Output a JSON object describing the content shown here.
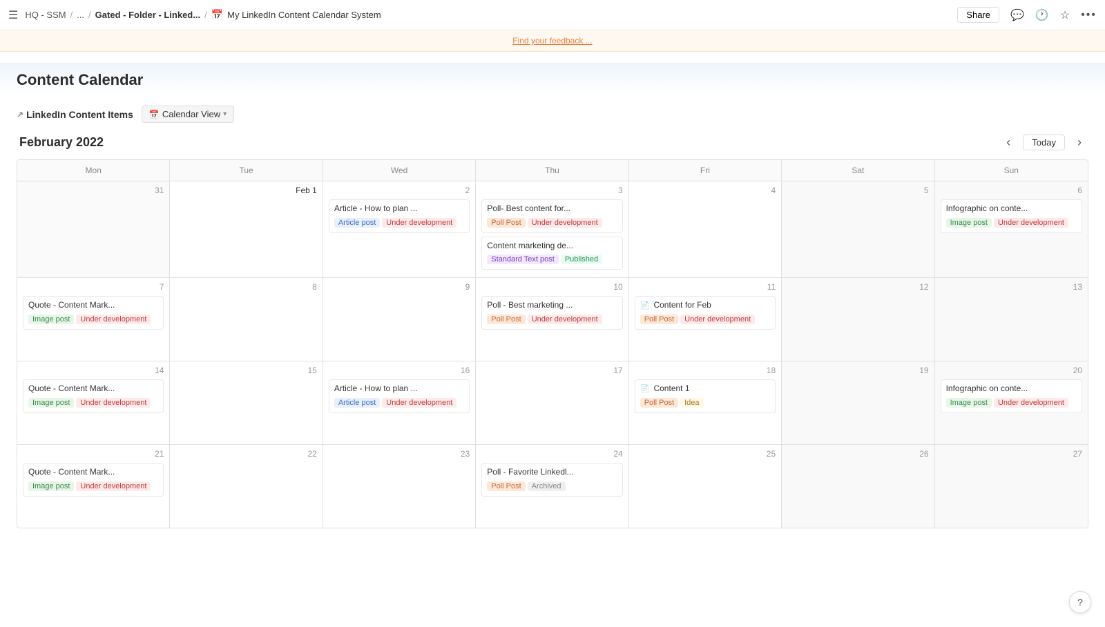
{
  "topbar": {
    "menu_icon": "☰",
    "breadcrumb": [
      {
        "label": "HQ - SSM",
        "sep": "/"
      },
      {
        "label": "...",
        "sep": "/"
      },
      {
        "label": "Gated - Folder - Linked...",
        "sep": "/"
      }
    ],
    "page_icon": "📅",
    "page_title": "My LinkedIn Content Calendar System",
    "share_label": "Share",
    "comment_icon": "💬",
    "clock_icon": "🕐",
    "star_icon": "★",
    "more_icon": "•••"
  },
  "banner": {
    "text": "Find your feedback ...",
    "link": "Find your feedback ..."
  },
  "section_title": "Content Calendar",
  "items_header": {
    "arrow_icon": "↗",
    "link_label": "LinkedIn Content Items",
    "calendar_icon": "📅",
    "view_label": "Calendar View",
    "chevron": "▾"
  },
  "calendar": {
    "month_label": "February 2022",
    "today_label": "Today",
    "prev_icon": "‹",
    "next_icon": "›",
    "day_headers": [
      "Mon",
      "Tue",
      "Wed",
      "Thu",
      "Fri",
      "Sat",
      "Sun"
    ],
    "weeks": [
      {
        "days": [
          {
            "number": "31",
            "outside": true,
            "events": []
          },
          {
            "number": "Feb 1",
            "first": true,
            "events": []
          },
          {
            "number": "2",
            "events": [
              {
                "title": "Article - How to plan ...",
                "tags": [
                  {
                    "label": "Article post",
                    "type": "article"
                  },
                  {
                    "label": "Under development",
                    "type": "under"
                  }
                ]
              }
            ]
          },
          {
            "number": "3",
            "events": [
              {
                "title": "Poll- Best content for...",
                "tags": [
                  {
                    "label": "Poll Post",
                    "type": "poll"
                  },
                  {
                    "label": "Under development",
                    "type": "under"
                  }
                ]
              },
              {
                "title": "Content marketing de...",
                "tags": [
                  {
                    "label": "Standard Text post",
                    "type": "standard"
                  },
                  {
                    "label": "Published",
                    "type": "published"
                  }
                ]
              }
            ]
          },
          {
            "number": "4",
            "events": []
          },
          {
            "number": "5",
            "weekend": true,
            "events": []
          },
          {
            "number": "6",
            "weekend": true,
            "events": [
              {
                "title": "Infographic on conte...",
                "tags": [
                  {
                    "label": "Image post",
                    "type": "image"
                  },
                  {
                    "label": "Under development",
                    "type": "under"
                  }
                ]
              }
            ]
          }
        ]
      },
      {
        "days": [
          {
            "number": "7",
            "events": [
              {
                "title": "Quote - Content Mark...",
                "tags": [
                  {
                    "label": "Image post",
                    "type": "image"
                  },
                  {
                    "label": "Under development",
                    "type": "under"
                  }
                ]
              }
            ]
          },
          {
            "number": "8",
            "events": []
          },
          {
            "number": "9",
            "events": []
          },
          {
            "number": "10",
            "events": [
              {
                "title": "Poll - Best marketing ...",
                "tags": [
                  {
                    "label": "Poll Post",
                    "type": "poll"
                  },
                  {
                    "label": "Under development",
                    "type": "under"
                  }
                ]
              }
            ]
          },
          {
            "number": "11",
            "events": [
              {
                "title": "Content for Feb",
                "doc_icon": "📄",
                "tags": [
                  {
                    "label": "Poll Post",
                    "type": "poll"
                  },
                  {
                    "label": "Under development",
                    "type": "under"
                  }
                ]
              }
            ]
          },
          {
            "number": "12",
            "weekend": true,
            "events": []
          },
          {
            "number": "13",
            "weekend": true,
            "events": []
          }
        ]
      },
      {
        "days": [
          {
            "number": "14",
            "events": [
              {
                "title": "Quote - Content Mark...",
                "tags": [
                  {
                    "label": "Image post",
                    "type": "image"
                  },
                  {
                    "label": "Under development",
                    "type": "under"
                  }
                ]
              }
            ]
          },
          {
            "number": "15",
            "events": []
          },
          {
            "number": "16",
            "events": [
              {
                "title": "Article - How to plan ...",
                "tags": [
                  {
                    "label": "Article post",
                    "type": "article"
                  },
                  {
                    "label": "Under development",
                    "type": "under"
                  }
                ]
              }
            ]
          },
          {
            "number": "17",
            "events": []
          },
          {
            "number": "18",
            "events": [
              {
                "title": "Content 1",
                "doc_icon": "📄",
                "tags": [
                  {
                    "label": "Poll Post",
                    "type": "poll"
                  },
                  {
                    "label": "Idea",
                    "type": "idea"
                  }
                ]
              }
            ]
          },
          {
            "number": "19",
            "weekend": true,
            "events": []
          },
          {
            "number": "20",
            "weekend": true,
            "events": [
              {
                "title": "Infographic on conte...",
                "tags": [
                  {
                    "label": "Image post",
                    "type": "image"
                  },
                  {
                    "label": "Under development",
                    "type": "under"
                  }
                ]
              }
            ]
          }
        ]
      },
      {
        "days": [
          {
            "number": "21",
            "events": [
              {
                "title": "Quote - Content Mark...",
                "tags": [
                  {
                    "label": "Image post",
                    "type": "image"
                  },
                  {
                    "label": "Under development",
                    "type": "under"
                  }
                ]
              }
            ]
          },
          {
            "number": "22",
            "events": []
          },
          {
            "number": "23",
            "events": []
          },
          {
            "number": "24",
            "events": [
              {
                "title": "Poll - Favorite Linkedl...",
                "tags": [
                  {
                    "label": "Poll Post",
                    "type": "poll"
                  },
                  {
                    "label": "Archived",
                    "type": "archived"
                  }
                ]
              }
            ]
          },
          {
            "number": "25",
            "events": []
          },
          {
            "number": "26",
            "weekend": true,
            "events": []
          },
          {
            "number": "27",
            "weekend": true,
            "events": []
          }
        ]
      }
    ]
  },
  "help_label": "?"
}
